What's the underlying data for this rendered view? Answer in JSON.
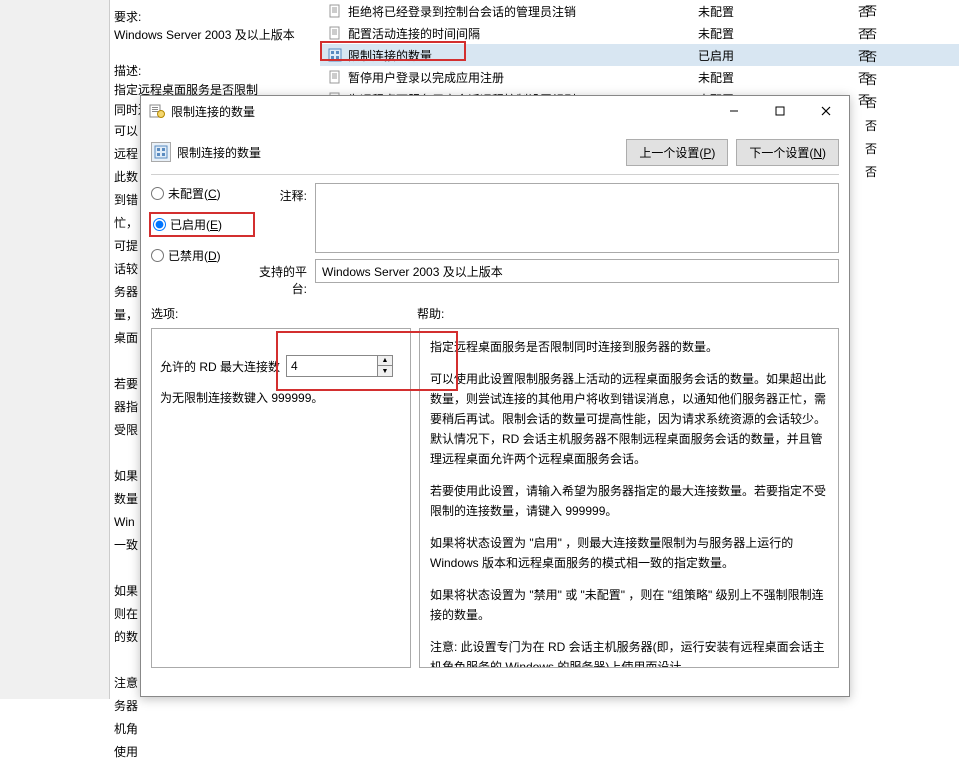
{
  "bg": {
    "requirements_label": "要求:",
    "requirements_text": "Windows Server 2003 及以上版本",
    "description_label": "描述:",
    "description_text": "指定远程桌面服务是否限制同时连接到服",
    "side_chars": [
      "可以",
      "远程",
      "此数",
      "到错",
      "忙，",
      "可提",
      "话较",
      "务器",
      "量，",
      "桌面",
      "",
      "若要",
      "器指",
      "受限",
      "",
      "如果",
      "数量",
      "Win",
      "一致",
      "",
      "如果",
      "则在",
      "的数",
      "",
      "注意",
      "务器",
      "机角",
      "使用"
    ],
    "rows": [
      {
        "icon": "doc-icon",
        "title": "拒绝将已经登录到控制台会话的管理员注销",
        "status": "未配置",
        "flag": "否"
      },
      {
        "icon": "doc-icon",
        "title": "配置活动连接的时间间隔",
        "status": "未配置",
        "flag": "否"
      },
      {
        "icon": "cfg-icon",
        "title": "限制连接的数量",
        "status": "已启用",
        "flag": "否",
        "selected": true
      },
      {
        "icon": "doc-icon",
        "title": "暂停用户登录以完成应用注册",
        "status": "未配置",
        "flag": "否"
      },
      {
        "icon": "doc-icon",
        "title": "为远程卓面服务用户会话远程控制设置规则",
        "status": "未配置",
        "flag": "否"
      }
    ],
    "side_flags": [
      "否",
      "否",
      "否",
      "否",
      "否",
      "否",
      "否",
      "否"
    ]
  },
  "dialog": {
    "title": "限制连接的数量",
    "nav_label": "限制连接的数量",
    "prev_btn_prefix": "上一个设置(",
    "prev_btn_key": "P",
    "next_btn_prefix": "下一个设置(",
    "next_btn_key": "N",
    "btn_suffix": ")",
    "radio_notconfig_prefix": "未配置(",
    "radio_notconfig_key": "C",
    "radio_enabled_prefix": "已启用(",
    "radio_enabled_key": "E",
    "radio_disabled_prefix": "已禁用(",
    "radio_disabled_key": "D",
    "comment_label": "注释:",
    "platform_label": "支持的平台:",
    "platform_value": "Windows Server 2003 及以上版本",
    "options_label": "选项:",
    "help_label": "帮助:",
    "max_conn_label": "允许的 RD 最大连接数",
    "max_conn_value": "4",
    "max_conn_note": "为无限制连接数键入 999999。",
    "help_paragraphs": [
      "指定远程桌面服务是否限制同时连接到服务器的数量。",
      "可以使用此设置限制服务器上活动的远程桌面服务会话的数量。如果超出此数量，则尝试连接的其他用户将收到错误消息，以通知他们服务器正忙，需要稍后再试。限制会话的数量可提高性能，因为请求系统资源的会话较少。默认情况下，RD 会话主机服务器不限制远程桌面服务会话的数量，并且管理远程桌面允许两个远程桌面服务会话。",
      "若要使用此设置，请输入希望为服务器指定的最大连接数量。若要指定不受限制的连接数量，请键入 999999。",
      "如果将状态设置为 \"启用\" ，则最大连接数量限制为与服务器上运行的 Windows 版本和远程桌面服务的模式相一致的指定数量。",
      "如果将状态设置为 \"禁用\" 或 \"未配置\" ，则在 \"组策略\" 级别上不强制限制连接的数量。",
      "注意: 此设置专门为在 RD 会话主机服务器(即，运行安装有远程桌面会话主机角色服务的 Windows 的服务器)上使用而设计。"
    ]
  }
}
